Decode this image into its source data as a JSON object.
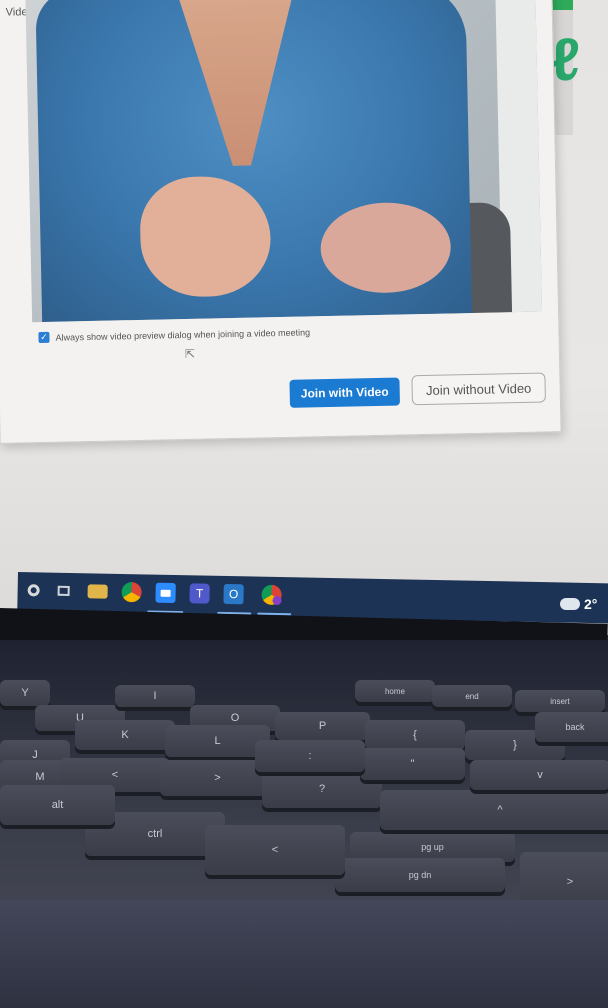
{
  "dialog": {
    "title": "Video Preview",
    "checkbox_label": "Always show video preview dialog when joining a video meeting",
    "checkbox_checked": true,
    "join_with_video": "Join with Video",
    "join_without_video": "Join without Video",
    "accent_color": "#1b7ad2"
  },
  "taskbar": {
    "icons": [
      {
        "name": "start-icon",
        "glyph": "◉"
      },
      {
        "name": "task-view-icon",
        "glyph": "▣"
      },
      {
        "name": "file-explorer-icon",
        "glyph": "▬"
      },
      {
        "name": "chrome-icon",
        "glyph": "●"
      },
      {
        "name": "zoom-icon",
        "glyph": "■",
        "active": true
      },
      {
        "name": "teams-icon",
        "glyph": "T"
      },
      {
        "name": "outlook-icon",
        "glyph": "O",
        "active": true
      },
      {
        "name": "chrome-profile-icon",
        "glyph": "●",
        "active": true
      }
    ],
    "weather_temp": "2°"
  },
  "keyboard": {
    "keys": [
      "Y",
      "U",
      "I",
      "O",
      "P",
      "J",
      "K",
      "L",
      "M",
      "<",
      ">",
      "?",
      "ctrl",
      "alt",
      "{",
      "}",
      "\"",
      ":",
      "home",
      "end",
      "insert",
      "back",
      "pg up",
      "pg dn",
      "<",
      "^",
      "v",
      ">"
    ]
  }
}
